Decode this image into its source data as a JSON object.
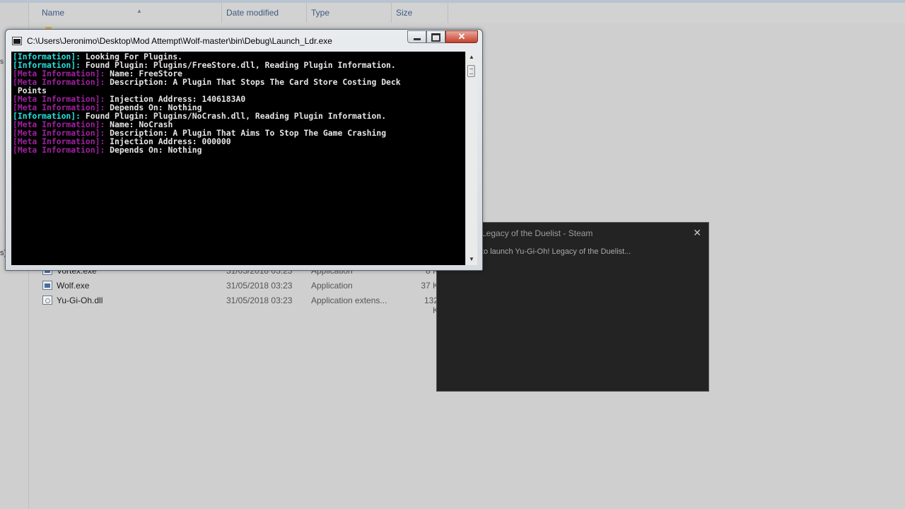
{
  "explorer": {
    "columns": {
      "name": "Name",
      "date": "Date modified",
      "type": "Type",
      "size": "Size"
    },
    "rows": [
      {
        "name": "Vortex.exe",
        "date": "31/05/2018 03:23",
        "type": "Application",
        "size": "8 K",
        "icon": "exe-icon"
      },
      {
        "name": "Wolf.exe",
        "date": "31/05/2018 03:23",
        "type": "Application",
        "size": "37 K",
        "icon": "exe-icon"
      },
      {
        "name": "Yu-Gi-Oh.dll",
        "date": "31/05/2018 03:23",
        "type": "Application extens...",
        "size": "132 K",
        "icon": "dll-icon"
      }
    ],
    "left_glyphs": [
      "s",
      "s)"
    ]
  },
  "steam_popup": {
    "title": "Legacy of the Duelist - Steam",
    "message": "to launch Yu-Gi-Oh! Legacy of the Duelist...",
    "close": "✕"
  },
  "console": {
    "title": "C:\\Users\\Jeronimo\\Desktop\\Mod Attempt\\Wolf-master\\bin\\Debug\\Launch_Ldr.exe",
    "buttons": {
      "minimize": "",
      "maximize": "",
      "close": "✕"
    },
    "lines": [
      {
        "tag": "[Information]:",
        "kind": "info",
        "text": " Looking For Plugins."
      },
      {
        "tag": "[Information]:",
        "kind": "info",
        "text": " Found Plugin: Plugins/FreeStore.dll, Reading Plugin Information."
      },
      {
        "tag": "[Meta Information]:",
        "kind": "meta",
        "text": " Name: FreeStore"
      },
      {
        "tag": "[Meta Information]:",
        "kind": "meta",
        "text": " Description: A Plugin That Stops The Card Store Costing Deck"
      },
      {
        "tag": "",
        "kind": "plain",
        "text": " Points"
      },
      {
        "tag": "[Meta Information]:",
        "kind": "meta",
        "text": " Injection Address: 1406183A0"
      },
      {
        "tag": "[Meta Information]:",
        "kind": "meta",
        "text": " Depends On: Nothing"
      },
      {
        "tag": "[Information]:",
        "kind": "info",
        "text": " Found Plugin: Plugins/NoCrash.dll, Reading Plugin Information."
      },
      {
        "tag": "[Meta Information]:",
        "kind": "meta",
        "text": " Name: NoCrash"
      },
      {
        "tag": "[Meta Information]:",
        "kind": "meta",
        "text": " Description: A Plugin That Aims To Stop The Game Crashing"
      },
      {
        "tag": "[Meta Information]:",
        "kind": "meta",
        "text": " Injection Address: 000000"
      },
      {
        "tag": "[Meta Information]:",
        "kind": "meta",
        "text": " Depends On: Nothing"
      }
    ],
    "colors": {
      "info_tag": "#27e0e0",
      "meta_tag": "#a020a0",
      "text": "#e6e6e6",
      "background": "#000000"
    }
  }
}
